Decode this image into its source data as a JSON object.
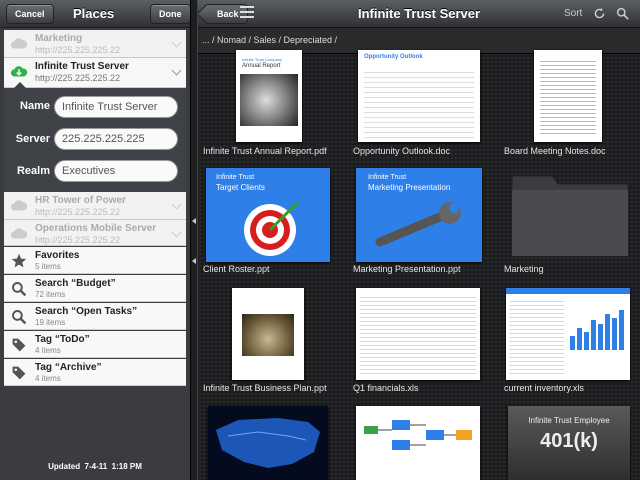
{
  "left": {
    "cancel_label": "Cancel",
    "title": "Places",
    "done_label": "Done",
    "servers": [
      {
        "name": "Marketing",
        "address": "http://225.225.225.22"
      },
      {
        "name": "Infinite Trust Server",
        "address": "http://225.225.225.22"
      }
    ],
    "edit": {
      "name_label": "Name",
      "name_value": "Infinite Trust Server",
      "server_label": "Server",
      "server_value": "225.225.225.225",
      "realm_label": "Realm",
      "realm_value": "Executives"
    },
    "servers2": [
      {
        "name": "HR Tower of Power",
        "address": "http://225.225.225.22"
      },
      {
        "name": "Operations Mobile Server",
        "address": "http://225.225.225.22"
      }
    ],
    "lists": [
      {
        "name": "Favorites",
        "count": "5 items",
        "icon": "star-icon"
      },
      {
        "name": "Search “Budget”",
        "count": "72 items",
        "icon": "search-icon"
      },
      {
        "name": "Search “Open Tasks”",
        "count": "19 items",
        "icon": "search-icon"
      },
      {
        "name": "Tag “ToDo”",
        "count": "4 items",
        "icon": "tag-icon"
      },
      {
        "name": "Tag “Archive”",
        "count": "4 items",
        "icon": "tag-icon"
      }
    ],
    "updated_label": "Updated",
    "updated_date": "7-4-11",
    "updated_time": "1:18 PM"
  },
  "right": {
    "back_label": "Back",
    "title": "Infinite Trust Server",
    "sort_label": "Sort",
    "breadcrumb": "... / Nomad / Sales / Depreciated /",
    "files": [
      {
        "name": "Infinite Trust Annual Report.pdf",
        "kind": "doc",
        "doc_brand": "Infinite Trust Company",
        "doc_title": "Annual Report"
      },
      {
        "name": "Opportunity Outlook.doc",
        "kind": "doc",
        "doc_title": "Opportunity Outlook"
      },
      {
        "name": "Board Meeting Notes.doc",
        "kind": "doc"
      },
      {
        "name": "Client Roster.ppt",
        "kind": "slide",
        "slide_brand": "Infinite Trust",
        "slide_title": "Target Clients"
      },
      {
        "name": "Marketing Presentation.ppt",
        "kind": "slide",
        "slide_brand": "Infinite Trust",
        "slide_title": "Marketing Presentation"
      },
      {
        "name": "Marketing",
        "kind": "folder"
      },
      {
        "name": "Infinite Trust Business Plan.ppt",
        "kind": "doc"
      },
      {
        "name": "Q1 financials.xls",
        "kind": "sheet"
      },
      {
        "name": "current inventory.xls",
        "kind": "sheet"
      },
      {
        "name": "",
        "kind": "map"
      },
      {
        "name": "",
        "kind": "flow"
      },
      {
        "name": "",
        "kind": "leather",
        "leather_line1": "Infinite Trust Employee",
        "leather_line2": "401(k)"
      }
    ]
  },
  "colors": {
    "slide_blue": "#2f7fe8",
    "cloud_green": "#2fb24a",
    "dark_bg": "#1b1c1d"
  }
}
